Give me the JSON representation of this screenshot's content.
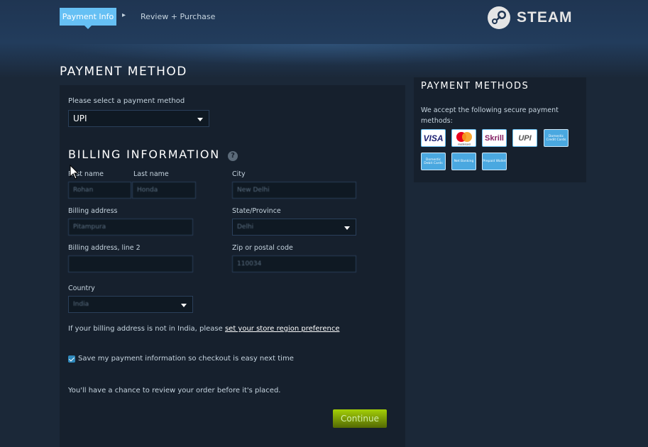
{
  "header": {
    "steps": [
      {
        "label": "Payment Info",
        "active": true
      },
      {
        "label": "Review + Purchase",
        "active": false
      }
    ],
    "logo_text": "STEAM"
  },
  "page_title": "PAYMENT METHOD",
  "payment": {
    "select_label": "Please select a payment method",
    "selected": "UPI"
  },
  "billing": {
    "title": "BILLING INFORMATION",
    "help": "?",
    "first_name_label": "First name",
    "first_name_value": "Rohan",
    "last_name_label": "Last name",
    "last_name_value": "Honda",
    "city_label": "City",
    "city_value": "New Delhi",
    "address_label": "Billing address",
    "address_value": "Pitampura",
    "state_label": "State/Province",
    "state_value": "Delhi",
    "address2_label": "Billing address, line 2",
    "address2_value": "",
    "zip_label": "Zip or postal code",
    "zip_value": "110034",
    "country_label": "Country",
    "country_value": "India",
    "region_text": "If your billing address is not in India, please ",
    "region_link": "set your store region preference",
    "save_label": "Save my payment information so checkout is easy next time",
    "save_checked": true,
    "review_text": "You'll have a chance to review your order before it's placed.",
    "continue_label": "Continue"
  },
  "side": {
    "title": "PAYMENT METHODS",
    "description": "We accept the following secure payment methods:",
    "methods": [
      {
        "name": "VISA",
        "icon": "visa-icon"
      },
      {
        "name": "mastercard",
        "icon": "mastercard-icon"
      },
      {
        "name": "Skrill",
        "icon": "skrill-icon"
      },
      {
        "name": "UPI",
        "icon": "upi-icon"
      },
      {
        "name": "Domestic Credit Cards",
        "icon": "domestic-credit-cards-icon"
      },
      {
        "name": "Domestic Debit Cards",
        "icon": "domestic-debit-cards-icon"
      },
      {
        "name": "Net Banking",
        "icon": "net-banking-icon"
      },
      {
        "name": "Prepaid Wallet",
        "icon": "prepaid-wallet-icon"
      }
    ]
  },
  "colors": {
    "background": "#1b2838",
    "panel": "#16202d",
    "accent": "#66c0f4",
    "continue_green": "#a4d007"
  }
}
